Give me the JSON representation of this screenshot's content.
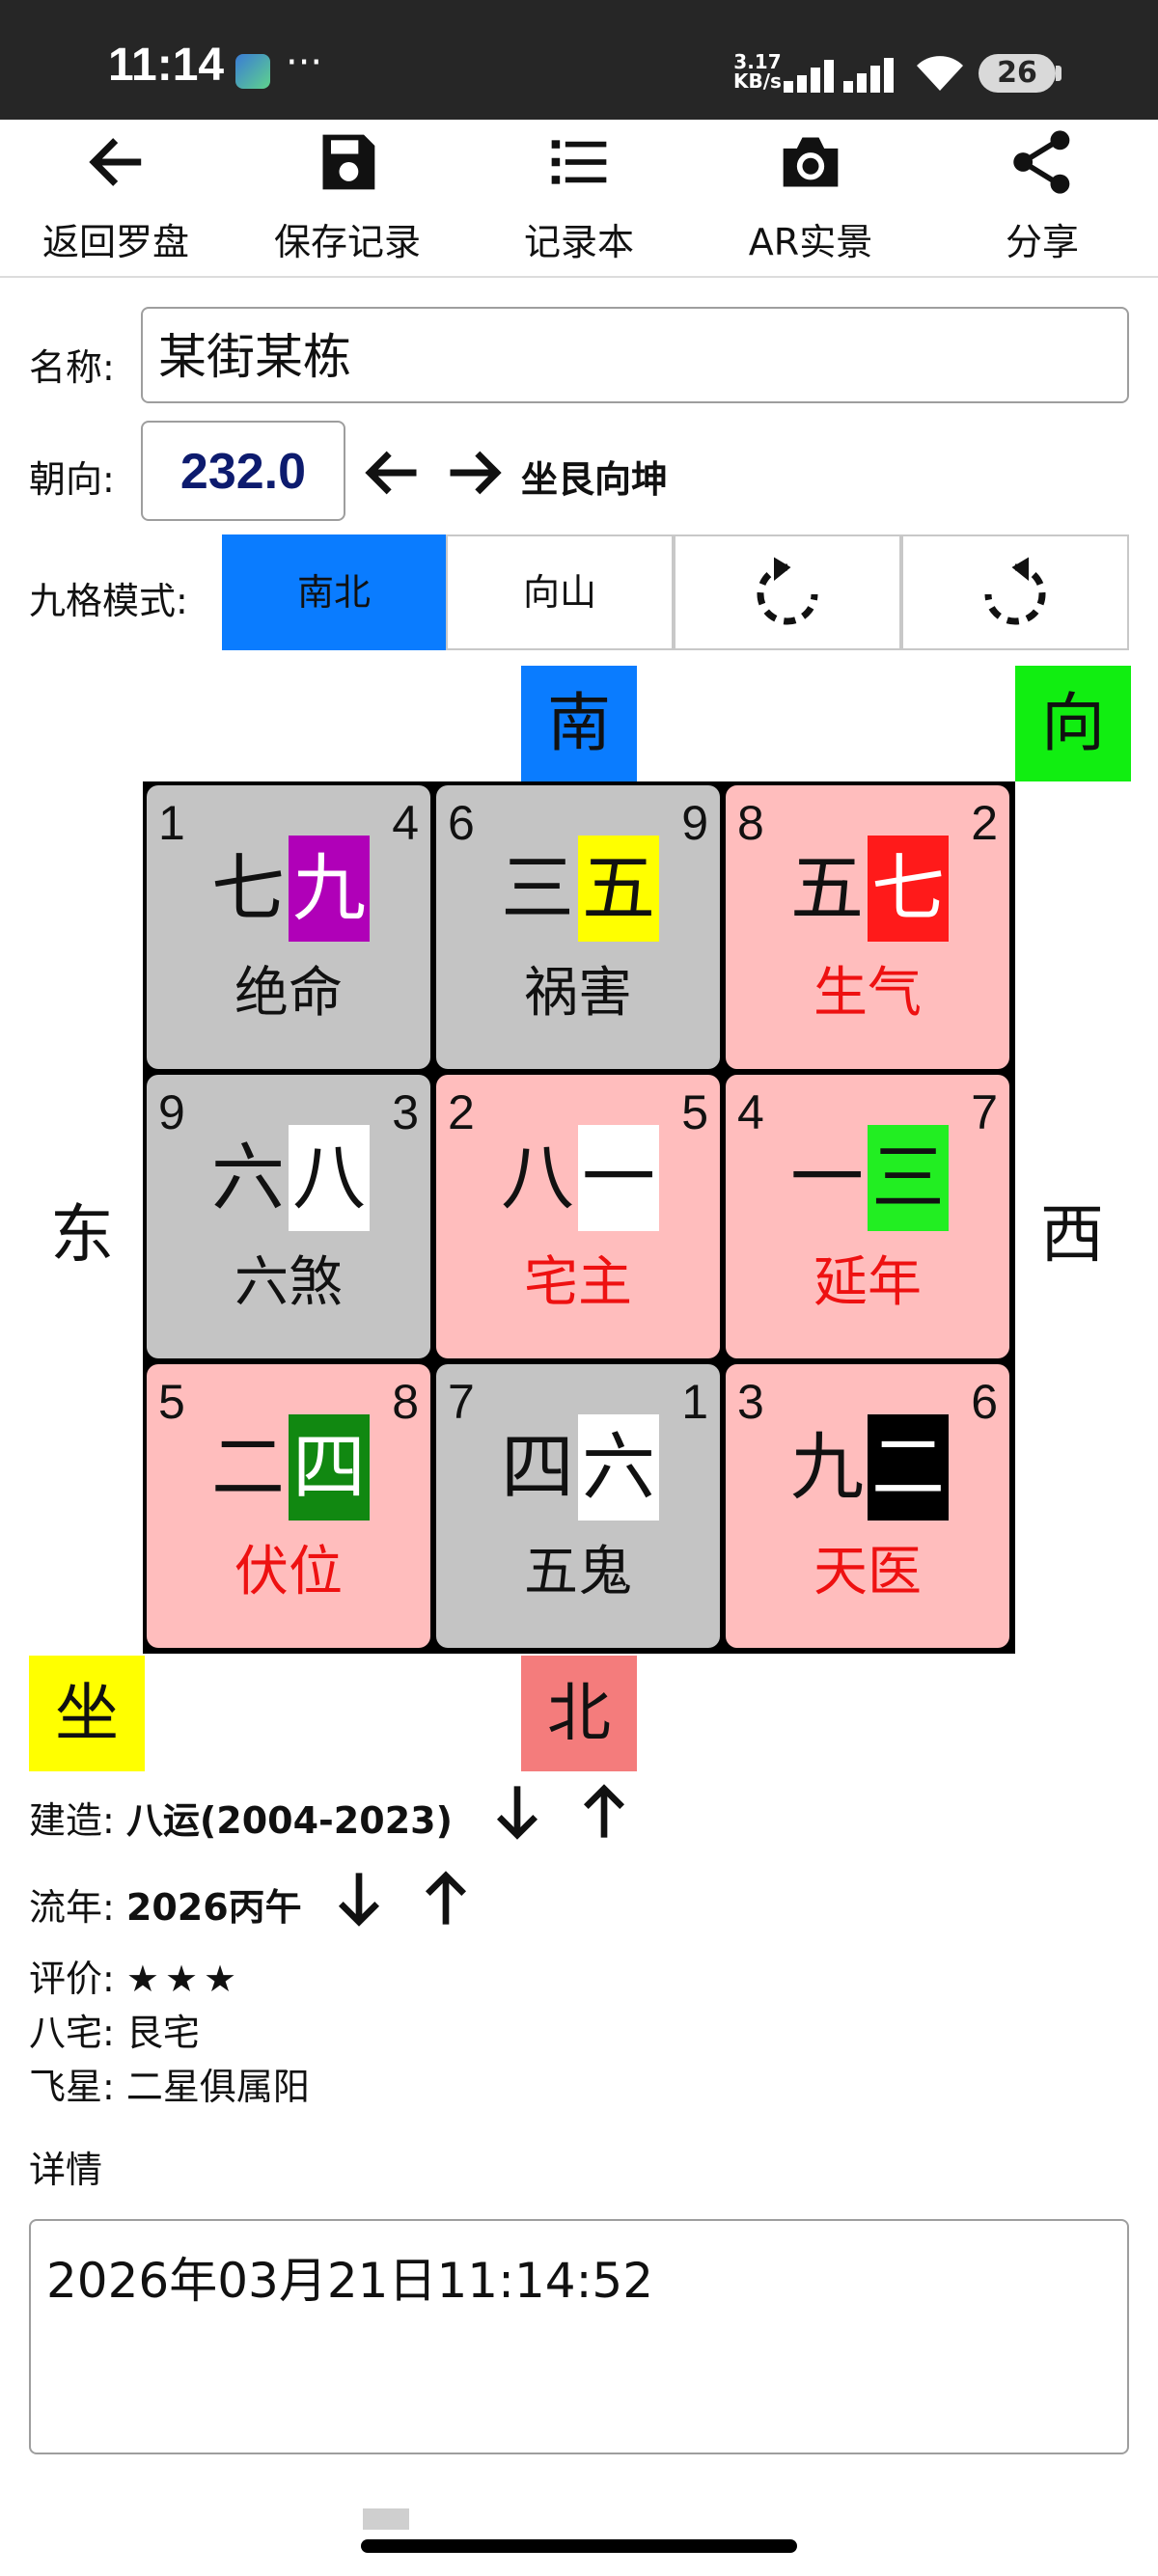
{
  "status_bar": {
    "time": "11:14",
    "more": "···",
    "net_speed_value": "3.17",
    "net_speed_unit": "KB/s",
    "battery": "26"
  },
  "toolbar": {
    "items": [
      {
        "label": "返回罗盘",
        "icon": "arrow-left-icon"
      },
      {
        "label": "保存记录",
        "icon": "save-icon"
      },
      {
        "label": "记录本",
        "icon": "list-icon"
      },
      {
        "label": "AR实景",
        "icon": "camera-icon"
      },
      {
        "label": "分享",
        "icon": "share-icon"
      }
    ]
  },
  "form": {
    "name_label": "名称:",
    "name_value": "某街某栋",
    "facing_label": "朝向:",
    "facing_value": "232.0",
    "sitting_facing": "坐艮向坤",
    "mode_label": "九格模式:",
    "modes": [
      "南北",
      "向山"
    ],
    "active_mode": "南北"
  },
  "directions": {
    "south": "南",
    "north": "北",
    "east": "东",
    "west": "西",
    "facing_tag": "向",
    "sitting_tag": "坐"
  },
  "grid": {
    "cells": [
      {
        "tl": "1",
        "tr": "4",
        "a": "七",
        "b": "九",
        "b_bg": "#b000b8",
        "b_fg": "#ffffff",
        "name": "绝命",
        "name_red": false,
        "bg": "gray"
      },
      {
        "tl": "6",
        "tr": "9",
        "a": "三",
        "b": "五",
        "b_bg": "#ffff00",
        "b_fg": "#111111",
        "name": "祸害",
        "name_red": false,
        "bg": "gray"
      },
      {
        "tl": "8",
        "tr": "2",
        "a": "五",
        "b": "七",
        "b_bg": "#ff1a1a",
        "b_fg": "#ffffff",
        "name": "生气",
        "name_red": true,
        "bg": "pink"
      },
      {
        "tl": "9",
        "tr": "3",
        "a": "六",
        "b": "八",
        "b_bg": "#ffffff",
        "b_fg": "#111111",
        "name": "六煞",
        "name_red": false,
        "bg": "gray"
      },
      {
        "tl": "2",
        "tr": "5",
        "a": "八",
        "b": "一",
        "b_bg": "#ffffff",
        "b_fg": "#111111",
        "name": "宅主",
        "name_red": true,
        "bg": "pink"
      },
      {
        "tl": "4",
        "tr": "7",
        "a": "一",
        "b": "三",
        "b_bg": "#22ee22",
        "b_fg": "#111111",
        "name": "延年",
        "name_red": true,
        "bg": "pink"
      },
      {
        "tl": "5",
        "tr": "8",
        "a": "二",
        "b": "四",
        "b_bg": "#118811",
        "b_fg": "#ffffff",
        "name": "伏位",
        "name_red": true,
        "bg": "pink"
      },
      {
        "tl": "7",
        "tr": "1",
        "a": "四",
        "b": "六",
        "b_bg": "#ffffff",
        "b_fg": "#111111",
        "name": "五鬼",
        "name_red": false,
        "bg": "gray"
      },
      {
        "tl": "3",
        "tr": "6",
        "a": "九",
        "b": "二",
        "b_bg": "#000000",
        "b_fg": "#ffffff",
        "name": "天医",
        "name_red": true,
        "bg": "pink"
      }
    ]
  },
  "info": {
    "build_label": "建造:",
    "build_value": "八运(2004-2023)",
    "year_label": "流年:",
    "year_value": "2026丙午",
    "rating_label": "评价:",
    "rating_value": "★★★",
    "bazhai_label": "八宅:",
    "bazhai_value": "艮宅",
    "flystar_label": "飞星:",
    "flystar_value": "二星俱属阳",
    "details_label": "详情",
    "details_value": "2026年03月21日11:14:52"
  },
  "colors": {
    "accent_blue": "#0a7cff",
    "facing_tag_bg": "#11ee11",
    "sitting_tag_bg": "#ffff00",
    "north_tag_bg": "#f47c7c",
    "south_tag_bg": "#0a7cff",
    "cell_gray": "#c4c4c4",
    "cell_pink": "#ffbdbd"
  }
}
